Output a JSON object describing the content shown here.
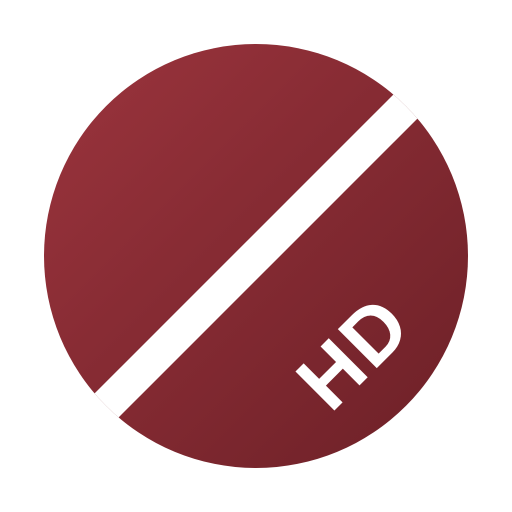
{
  "icon": {
    "label": "HD",
    "logo_name": "circle-slash-logo",
    "colors": {
      "background": "#ffffff",
      "disc_light": "#9b343d",
      "disc_dark": "#6c2027",
      "stripe": "#ffffff",
      "label": "#ffffff"
    }
  }
}
